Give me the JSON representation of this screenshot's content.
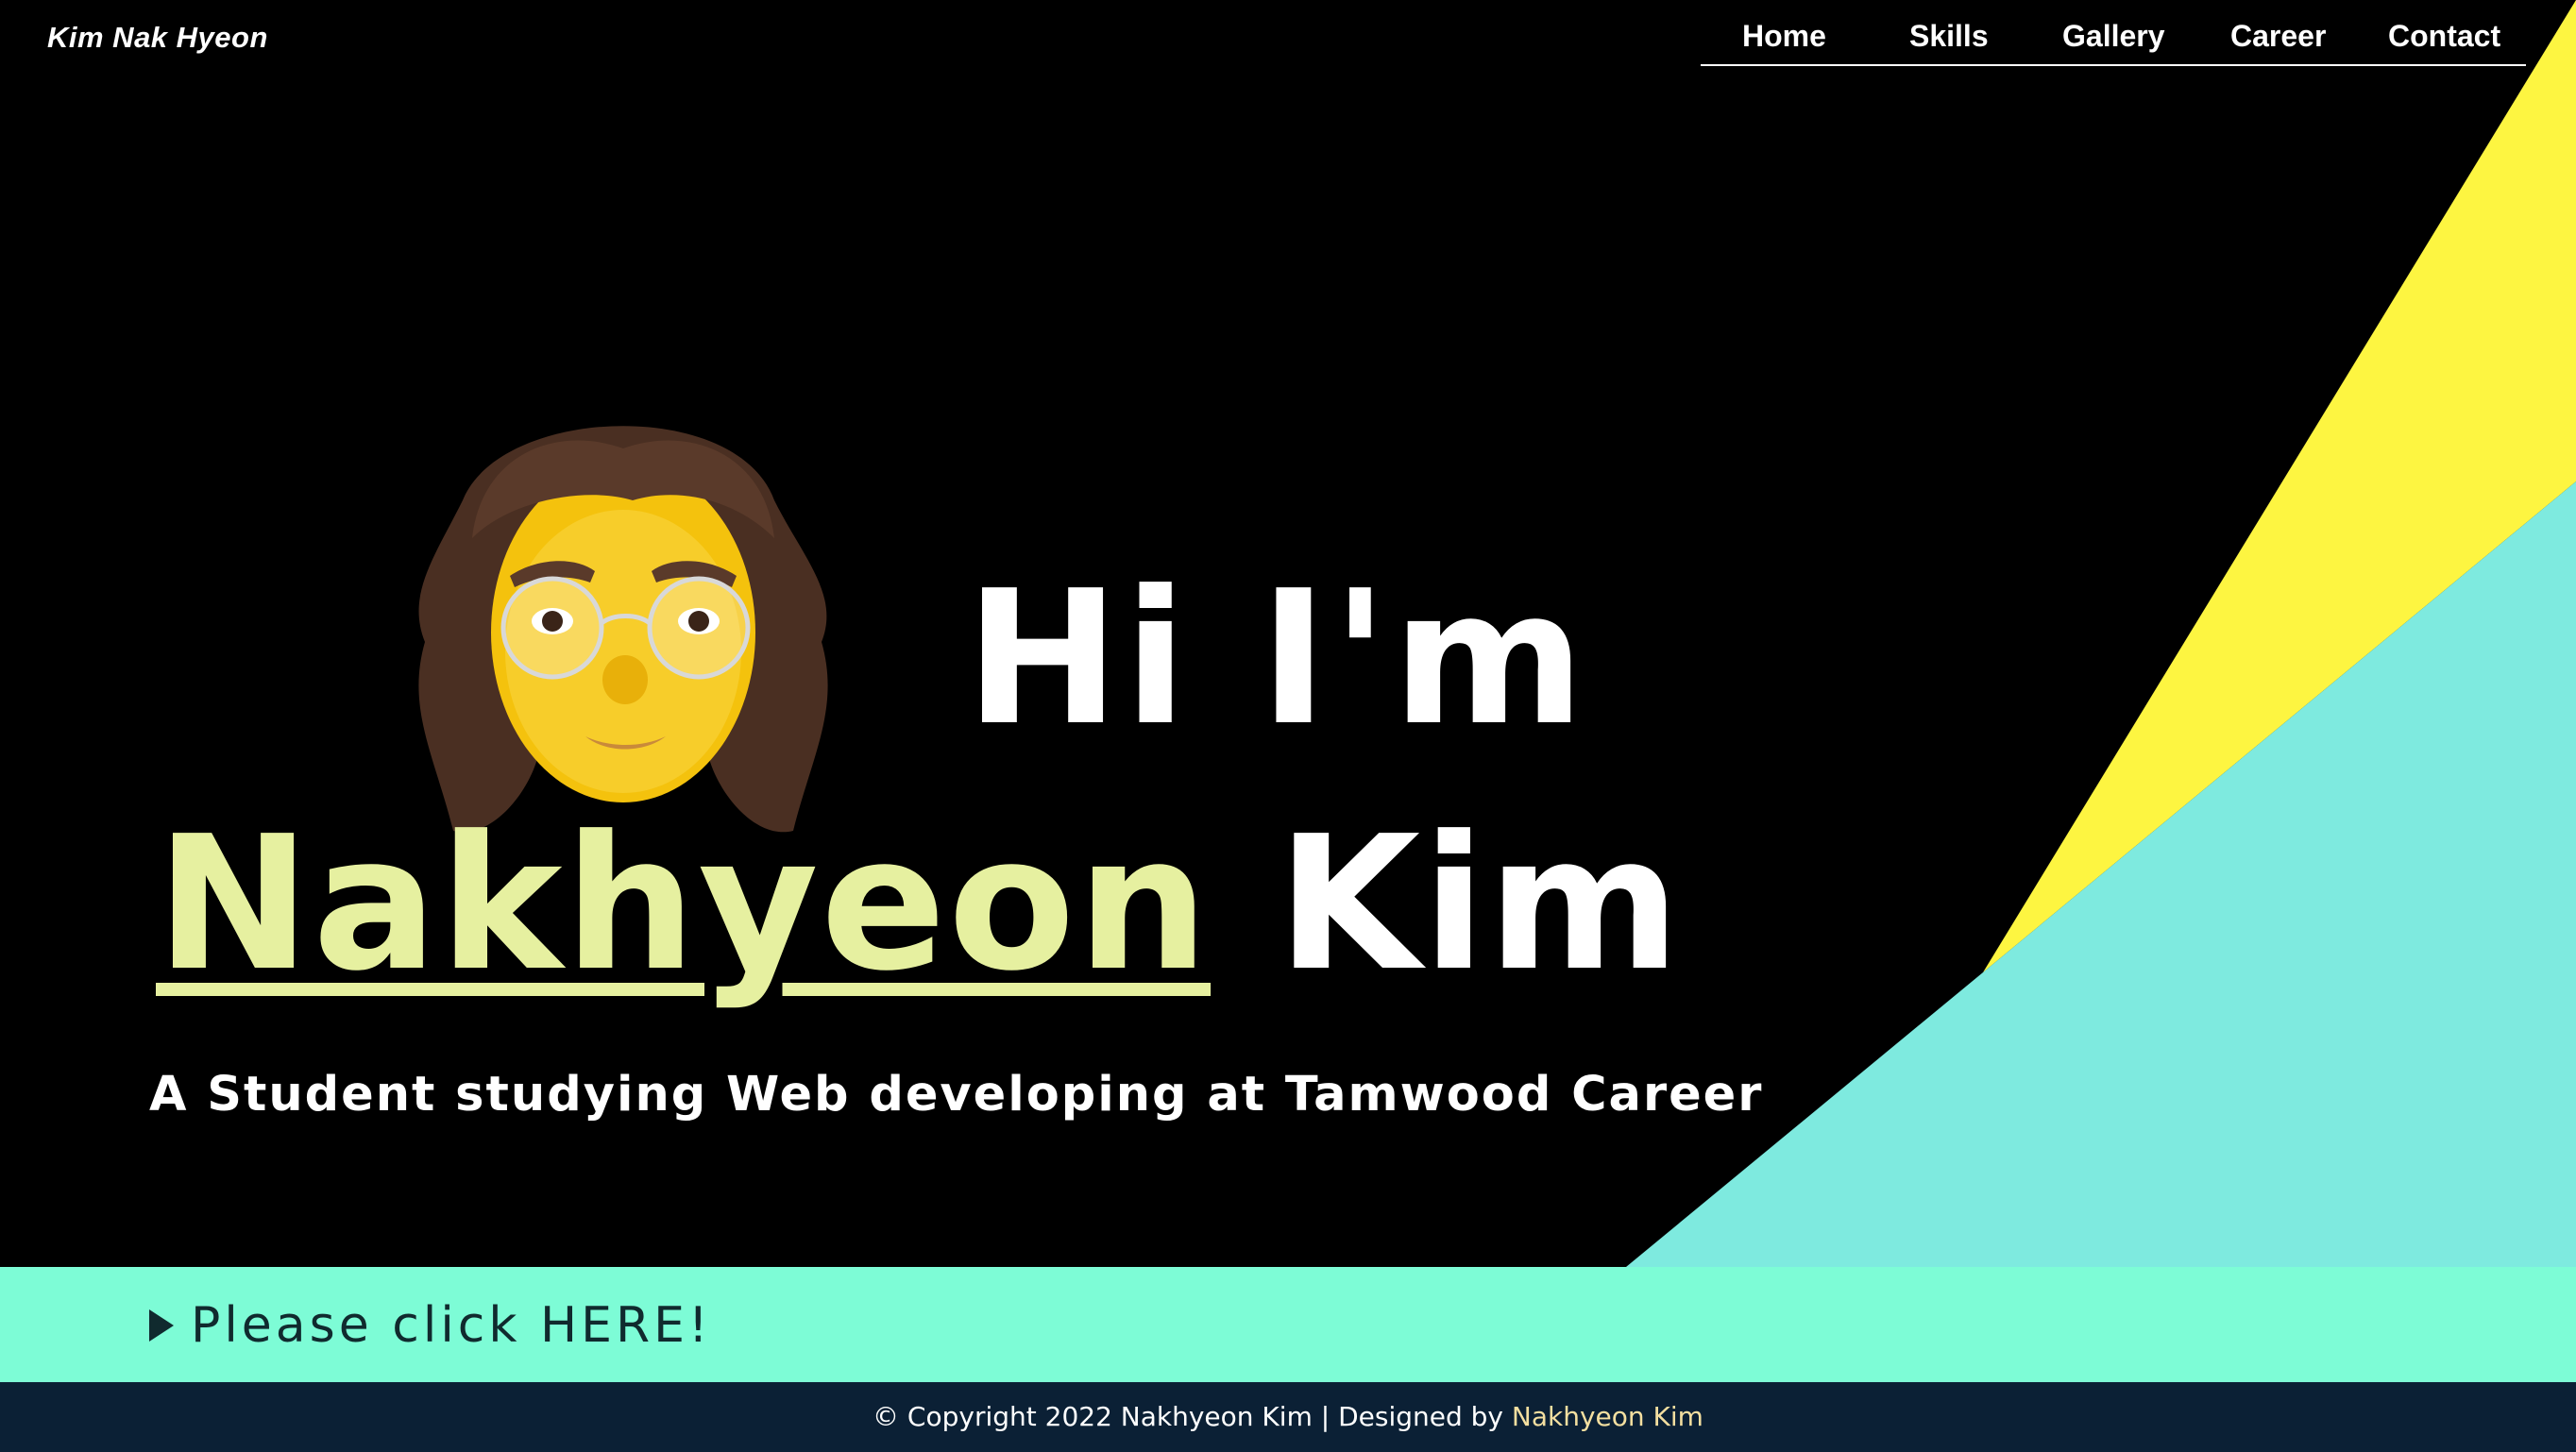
{
  "header": {
    "brand": "Kim Nak Hyeon",
    "nav": [
      {
        "label": "Home"
      },
      {
        "label": "Skills"
      },
      {
        "label": "Gallery"
      },
      {
        "label": "Career"
      },
      {
        "label": "Contact"
      }
    ]
  },
  "hero": {
    "greeting": "Hi I'm",
    "first_name": "Nakhyeon",
    "last_name": "Kim",
    "tagline": "A Student studying Web developing at Tamwood Career",
    "avatar_icon": "memoji-avatar"
  },
  "cta": {
    "label": "Please click HERE!",
    "icon": "play-arrow-icon"
  },
  "footer": {
    "copyright": "© Copyright 2022 Nakhyeon Kim | Designed by",
    "designer": "Nakhyeon Kim"
  },
  "colors": {
    "background": "#000000",
    "accent_yellow": "#fdf541",
    "accent_cyan": "#7eeadf",
    "name_highlight": "#e6f0a0",
    "cta_bar": "#7dfcd6",
    "footer_bg": "#0b2035",
    "footer_link": "#f4dfa0"
  }
}
